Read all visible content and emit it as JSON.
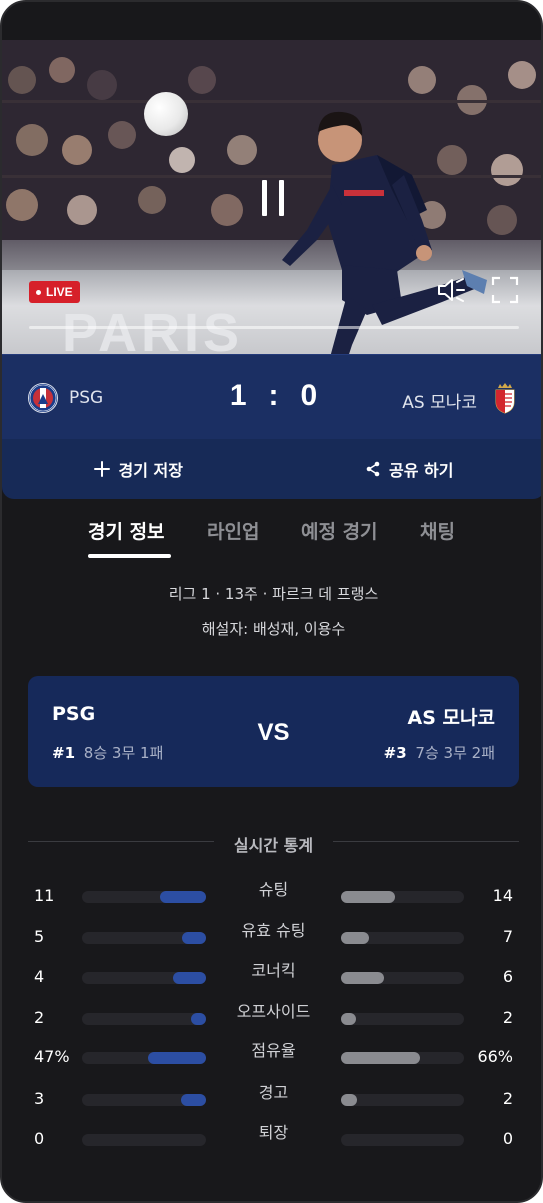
{
  "video": {
    "live_label": "LIVE",
    "billboard_text": "PARIS"
  },
  "colors": {
    "live": "#d6202a",
    "score_bar": "#1b2f63",
    "home_bar": "#2c4ea3",
    "away_bar": "#8a8b90"
  },
  "match": {
    "home_team": "PSG",
    "away_team": "AS 모나코",
    "home_score": "1",
    "separator": ":",
    "away_score": "0"
  },
  "actions": {
    "save_label": "경기 저장",
    "share_label": "공유 하기"
  },
  "tabs": [
    {
      "label": "경기 정보",
      "active": true
    },
    {
      "label": "라인업",
      "active": false
    },
    {
      "label": "예정 경기",
      "active": false
    },
    {
      "label": "채팅",
      "active": false
    }
  ],
  "info": {
    "line1": "리그 1 · 13주 · 파르크 데 프랭스",
    "line2": "해설자: 배성재, 이용수"
  },
  "versus": {
    "home_name": "PSG",
    "away_name": "AS 모나코",
    "vs_label": "VS",
    "home_rank": "#1",
    "home_record": "8승 3무 1패",
    "away_rank": "#3",
    "away_record": "7승 3무 2패"
  },
  "stats": {
    "title": "실시간 통계",
    "rows": [
      {
        "label": "슈팅",
        "home": "11",
        "away": "14",
        "home_fill": 0.37,
        "away_fill": 0.44
      },
      {
        "label": "유효 슈팅",
        "home": "5",
        "away": "7",
        "home_fill": 0.19,
        "away_fill": 0.23
      },
      {
        "label": "코너킥",
        "home": "4",
        "away": "6",
        "home_fill": 0.27,
        "away_fill": 0.35
      },
      {
        "label": "오프사이드",
        "home": "2",
        "away": "2",
        "home_fill": 0.12,
        "away_fill": 0.12
      },
      {
        "label": "점유율",
        "home": "47%",
        "away": "66%",
        "home_fill": 0.47,
        "away_fill": 0.64
      },
      {
        "label": "경고",
        "home": "3",
        "away": "2",
        "home_fill": 0.2,
        "away_fill": 0.13
      },
      {
        "label": "퇴장",
        "home": "0",
        "away": "0",
        "home_fill": 0,
        "away_fill": 0
      }
    ]
  }
}
